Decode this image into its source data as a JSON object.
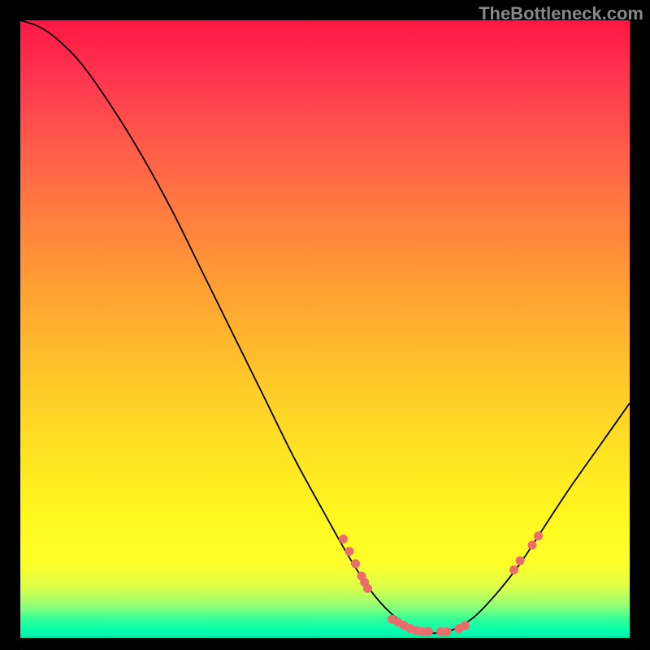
{
  "watermark": "TheBottleneck.com",
  "chart_data": {
    "type": "line",
    "title": "",
    "xlabel": "",
    "ylabel": "",
    "x_range": [
      0,
      100
    ],
    "y_range": [
      0,
      100
    ],
    "notes": "V-shaped bottleneck curve over rainbow gradient background (red=high bottleneck, green=low). Minimum (optimal) region roughly x 62-72.",
    "curve_points": [
      {
        "x": 0,
        "y": 100
      },
      {
        "x": 3,
        "y": 99
      },
      {
        "x": 6,
        "y": 97
      },
      {
        "x": 10,
        "y": 93
      },
      {
        "x": 15,
        "y": 86
      },
      {
        "x": 20,
        "y": 78
      },
      {
        "x": 25,
        "y": 69
      },
      {
        "x": 30,
        "y": 59
      },
      {
        "x": 35,
        "y": 49
      },
      {
        "x": 40,
        "y": 39
      },
      {
        "x": 45,
        "y": 29
      },
      {
        "x": 50,
        "y": 20
      },
      {
        "x": 54,
        "y": 13
      },
      {
        "x": 58,
        "y": 7
      },
      {
        "x": 62,
        "y": 3
      },
      {
        "x": 66,
        "y": 1
      },
      {
        "x": 70,
        "y": 1
      },
      {
        "x": 74,
        "y": 3
      },
      {
        "x": 78,
        "y": 7
      },
      {
        "x": 82,
        "y": 12
      },
      {
        "x": 86,
        "y": 18
      },
      {
        "x": 90,
        "y": 24
      },
      {
        "x": 95,
        "y": 31
      },
      {
        "x": 100,
        "y": 38
      }
    ],
    "markers": [
      {
        "x": 53,
        "y": 16
      },
      {
        "x": 54,
        "y": 14
      },
      {
        "x": 55,
        "y": 12
      },
      {
        "x": 56,
        "y": 10
      },
      {
        "x": 56.5,
        "y": 9
      },
      {
        "x": 57,
        "y": 8
      },
      {
        "x": 61,
        "y": 3
      },
      {
        "x": 62,
        "y": 2.5
      },
      {
        "x": 63,
        "y": 2
      },
      {
        "x": 64,
        "y": 1.5
      },
      {
        "x": 65,
        "y": 1.2
      },
      {
        "x": 66,
        "y": 1
      },
      {
        "x": 67,
        "y": 1
      },
      {
        "x": 69,
        "y": 1
      },
      {
        "x": 70,
        "y": 1
      },
      {
        "x": 72,
        "y": 1.5
      },
      {
        "x": 73,
        "y": 2
      },
      {
        "x": 81,
        "y": 11
      },
      {
        "x": 82,
        "y": 12.5
      },
      {
        "x": 84,
        "y": 15
      },
      {
        "x": 85,
        "y": 16.5
      }
    ],
    "marker_color": "#ec6b6b"
  }
}
